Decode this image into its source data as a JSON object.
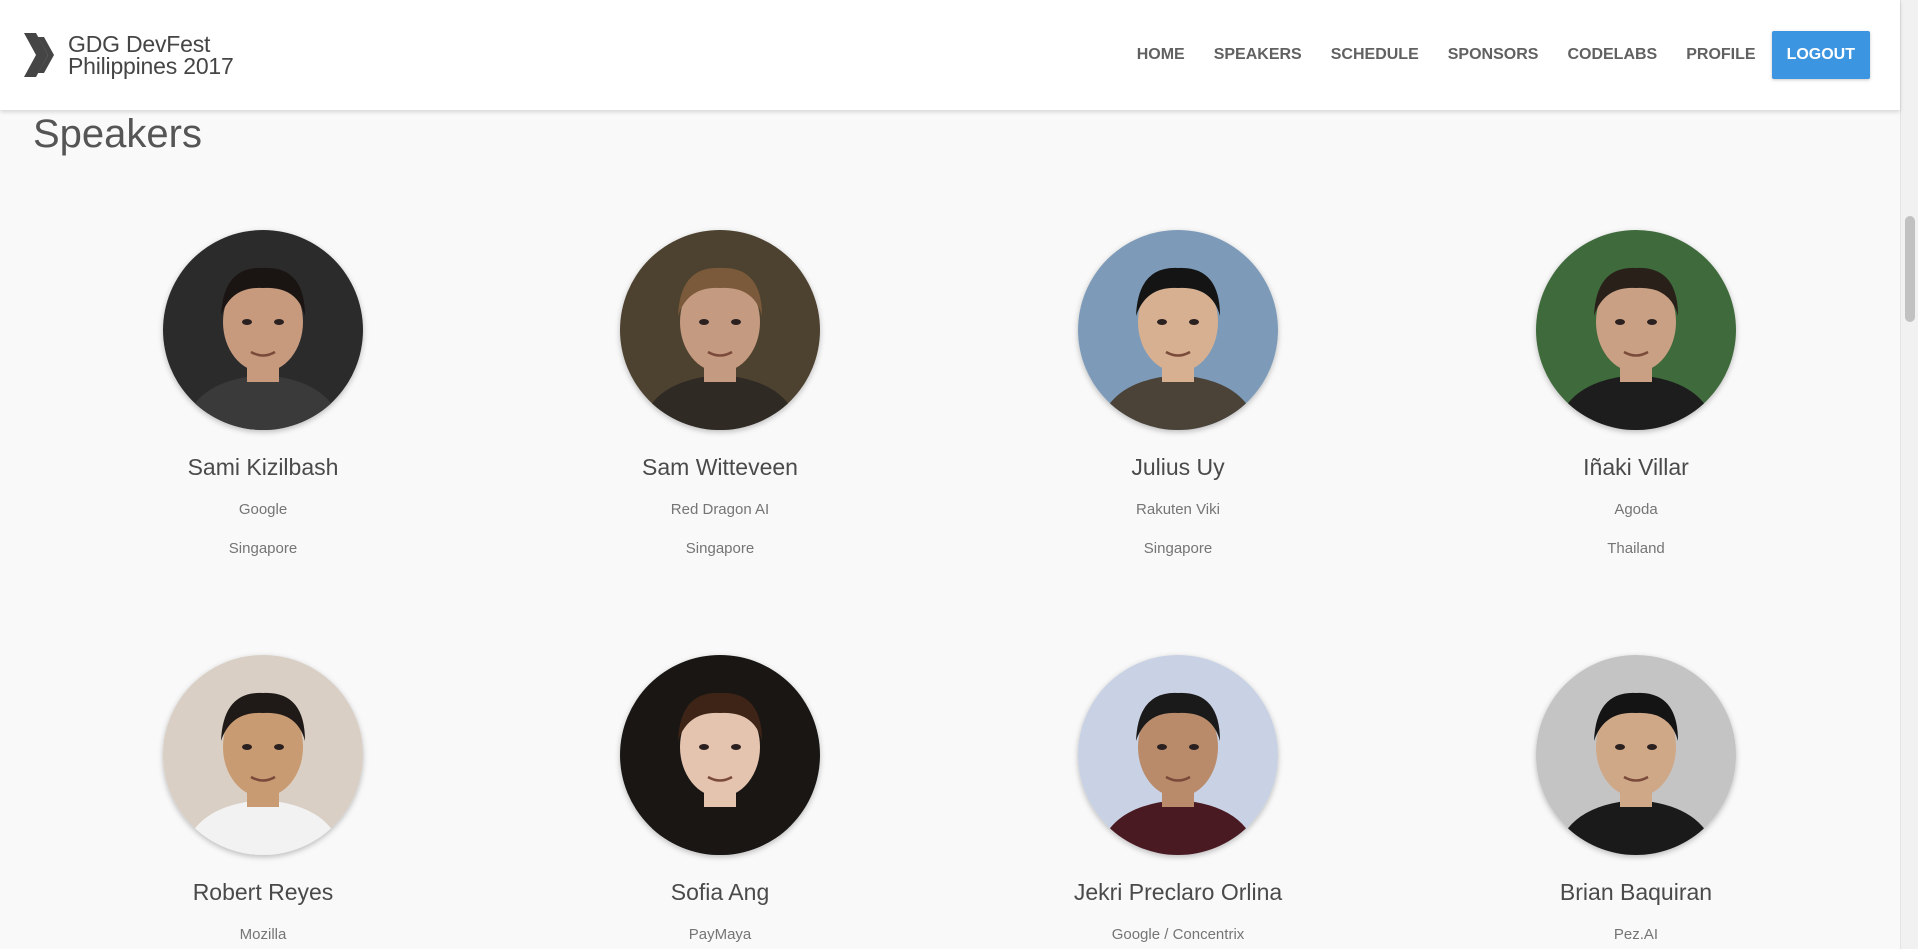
{
  "brand": {
    "line1": "GDG DevFest",
    "line2": "Philippines 2017"
  },
  "nav": {
    "items": [
      "HOME",
      "SPEAKERS",
      "SCHEDULE",
      "SPONSORS",
      "CODELABS",
      "PROFILE"
    ],
    "logout": "LOGOUT"
  },
  "page": {
    "title": "Speakers"
  },
  "speakers": [
    {
      "name": "Sami Kizilbash",
      "company": "Google",
      "location": "Singapore",
      "photo_colors": {
        "bg": "#2b2b2b",
        "skin": "#c79a7e",
        "hair": "#1a1412",
        "shirt": "#3a3a3a"
      }
    },
    {
      "name": "Sam Witteveen",
      "company": "Red Dragon AI",
      "location": "Singapore",
      "photo_colors": {
        "bg": "#4d4230",
        "skin": "#c49a80",
        "hair": "#7a5a3a",
        "shirt": "#2f2a24"
      }
    },
    {
      "name": "Julius Uy",
      "company": "Rakuten Viki",
      "location": "Singapore",
      "photo_colors": {
        "bg": "#7d9bb8",
        "skin": "#d6b090",
        "hair": "#141414",
        "shirt": "#4b4238"
      }
    },
    {
      "name": "Iñaki Villar",
      "company": "Agoda",
      "location": "Thailand",
      "photo_colors": {
        "bg": "#3f6a3c",
        "skin": "#c9a084",
        "hair": "#2a201a",
        "shirt": "#1d1d1d"
      }
    },
    {
      "name": "Robert Reyes",
      "company": "Mozilla",
      "location": "",
      "photo_colors": {
        "bg": "#d9cfc4",
        "skin": "#c99b72",
        "hair": "#1f1a17",
        "shirt": "#f2f2f2"
      }
    },
    {
      "name": "Sofia Ang",
      "company": "PayMaya",
      "location": "",
      "photo_colors": {
        "bg": "#1a1614",
        "skin": "#e4c4ae",
        "hair": "#3d2417",
        "shirt": "#1a1614"
      }
    },
    {
      "name": "Jekri Preclaro Orlina",
      "company": "Google / Concentrix",
      "location": "",
      "photo_colors": {
        "bg": "#c9d2e4",
        "skin": "#b98b6a",
        "hair": "#1b1a1a",
        "shirt": "#4a1a22"
      }
    },
    {
      "name": "Brian Baquiran",
      "company": "Pez.AI",
      "location": "",
      "photo_colors": {
        "bg": "#c4c4c4",
        "skin": "#cfa888",
        "hair": "#141414",
        "shirt": "#1a1a1a"
      }
    }
  ]
}
